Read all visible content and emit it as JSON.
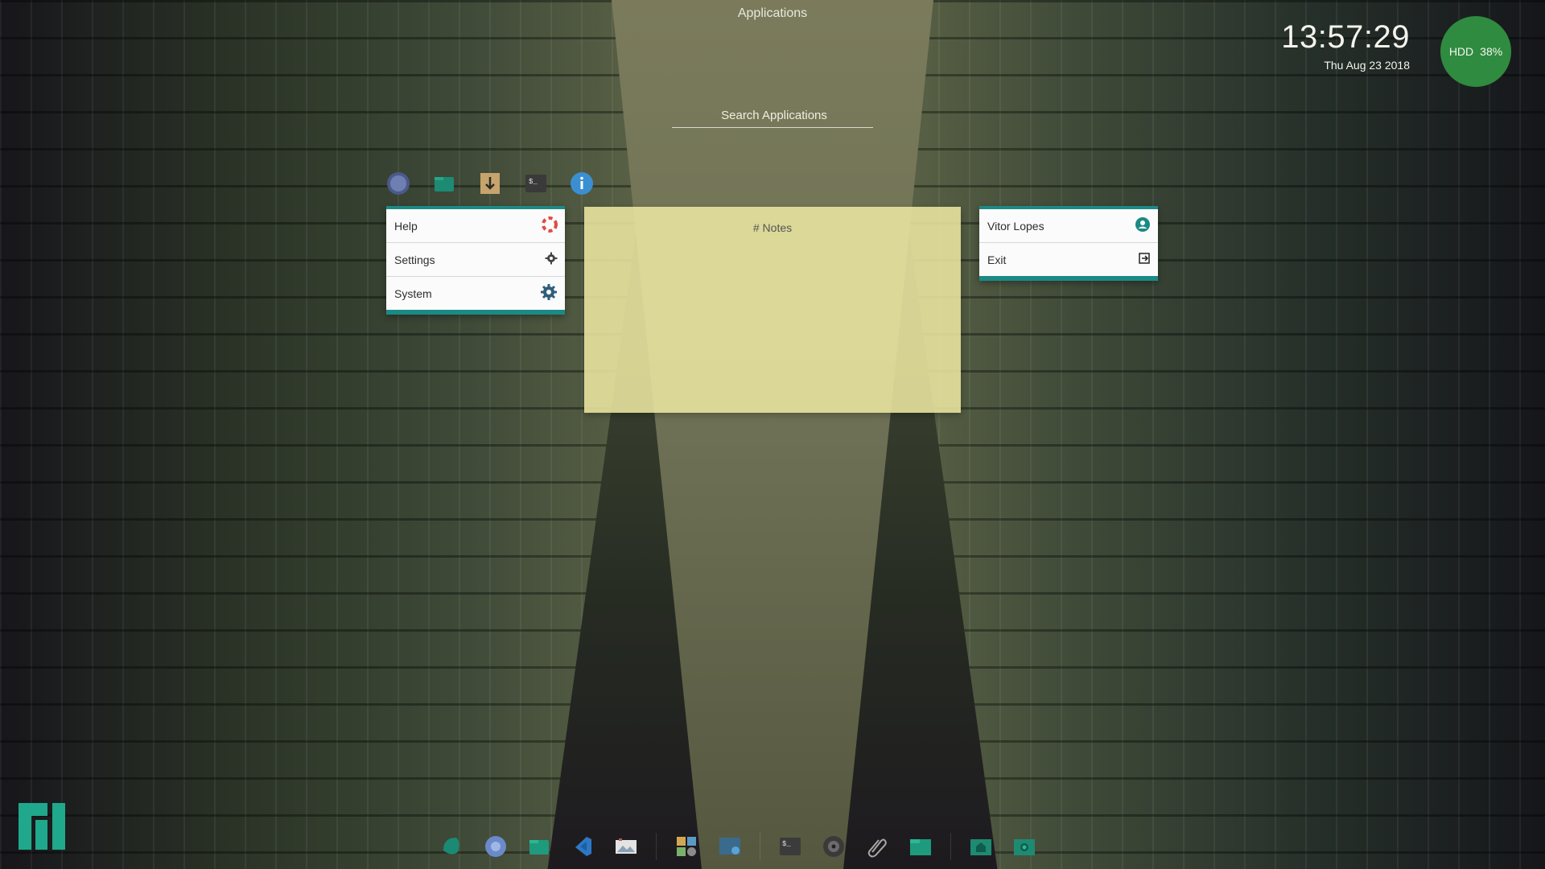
{
  "header": {
    "title": "Applications"
  },
  "search": {
    "placeholder": "Search Applications"
  },
  "clock": {
    "time": "13:57:29",
    "date": "Thu Aug 23 2018"
  },
  "hdd": {
    "label": "HDD",
    "value": "38%"
  },
  "favorites": [
    {
      "icon": "compass-icon"
    },
    {
      "icon": "files-folder-icon"
    },
    {
      "icon": "downloader-icon"
    },
    {
      "icon": "terminal-icon"
    },
    {
      "icon": "info-icon"
    }
  ],
  "left_menu": {
    "items": [
      {
        "label": "Help",
        "icon": "lifebuoy-icon"
      },
      {
        "label": "Settings",
        "icon": "gear-icon"
      },
      {
        "label": "System",
        "icon": "cog-icon"
      }
    ]
  },
  "right_menu": {
    "items": [
      {
        "label": "Vitor Lopes",
        "icon": "user-icon"
      },
      {
        "label": "Exit",
        "icon": "logout-icon"
      }
    ]
  },
  "notes": {
    "title": "# Notes"
  },
  "dock": {
    "items": [
      {
        "icon": "teal-app-icon"
      },
      {
        "icon": "browser-icon"
      },
      {
        "icon": "files-icon"
      },
      {
        "icon": "code-editor-icon"
      },
      {
        "icon": "image-viewer-icon"
      },
      {
        "icon": "settings-manager-icon"
      },
      {
        "icon": "screenshot-icon"
      },
      {
        "icon": "terminal-icon"
      },
      {
        "icon": "audio-icon"
      },
      {
        "icon": "paperclip-icon"
      },
      {
        "icon": "folder-icon"
      },
      {
        "icon": "home-folder-icon"
      },
      {
        "icon": "camera-icon"
      }
    ]
  },
  "colors": {
    "accent": "#1b8a86",
    "hdd": "#2f8b3f",
    "notes_bg": "#ebe6a0"
  }
}
